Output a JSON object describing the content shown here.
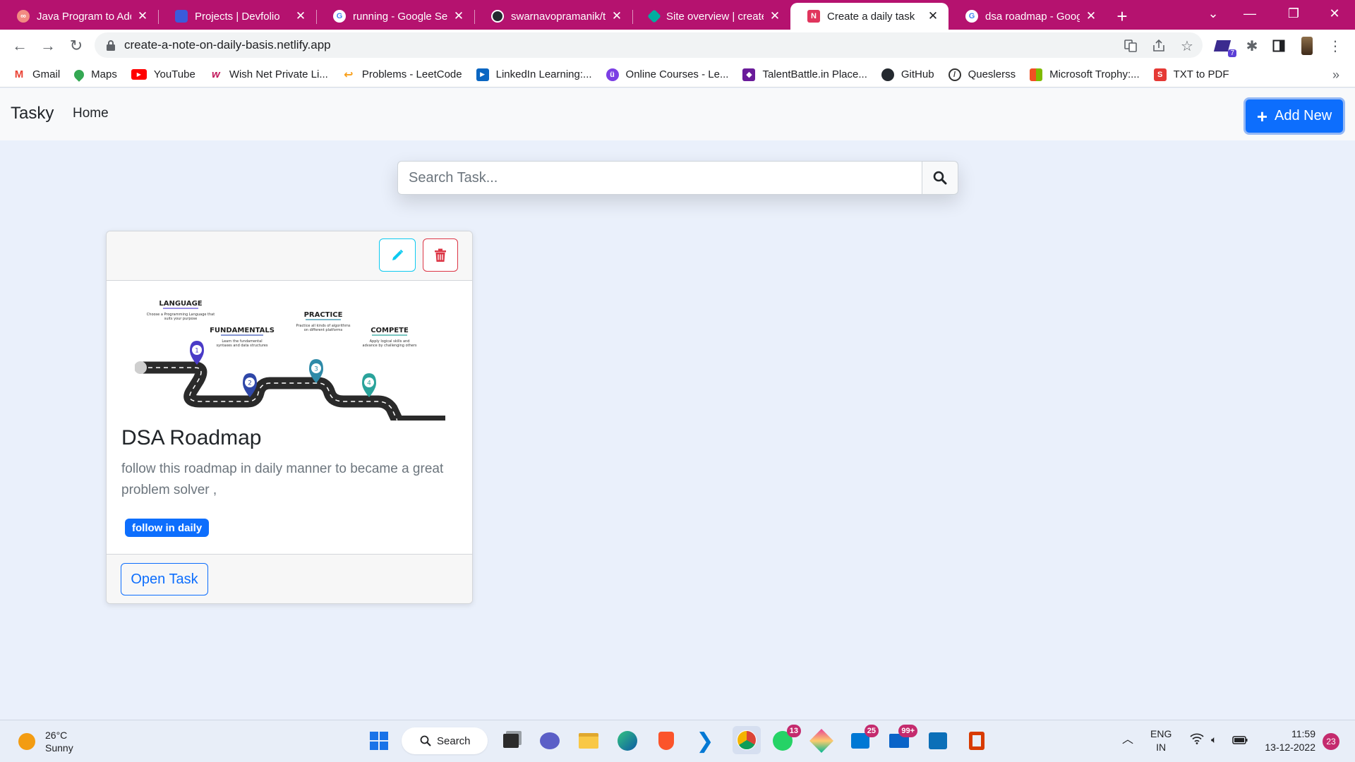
{
  "browser": {
    "tabs": [
      {
        "title": "Java Program to Add",
        "color": "#f28b82"
      },
      {
        "title": "Projects | Devfolio",
        "color": "#3b5bdb"
      },
      {
        "title": "running - Google Sea",
        "color": "#4285f4"
      },
      {
        "title": "swarnavopramanik/ta",
        "color": "#24292f"
      },
      {
        "title": "Site overview | create",
        "color": "#00ad9f"
      },
      {
        "title": "Create a daily task",
        "color": "#e0355d",
        "active": true
      },
      {
        "title": "dsa roadmap - Googl",
        "color": "#4285f4"
      }
    ],
    "url": "create-a-note-on-daily-basis.netlify.app",
    "extension_badge": "7",
    "bookmarks": [
      {
        "label": "Gmail",
        "color": "#ea4335"
      },
      {
        "label": "Maps",
        "color": "#34a853"
      },
      {
        "label": "YouTube",
        "color": "#ff0000"
      },
      {
        "label": "Wish Net Private Li...",
        "color": "#c2185b"
      },
      {
        "label": "Problems - LeetCode",
        "color": "#f89f1b"
      },
      {
        "label": "LinkedIn Learning:...",
        "color": "#0a66c2"
      },
      {
        "label": "Online Courses - Le...",
        "color": "#7b3fe4"
      },
      {
        "label": "TalentBattle.in Place...",
        "color": "#6a1b9a"
      },
      {
        "label": "GitHub",
        "color": "#24292f"
      },
      {
        "label": "Queslerss",
        "color": "#333333"
      },
      {
        "label": "Microsoft Trophy:...",
        "color": "#f25022"
      },
      {
        "label": "TXT to PDF",
        "color": "#e53935"
      }
    ],
    "bookmarks_more": "»"
  },
  "app": {
    "brand": "Tasky",
    "nav_home": "Home",
    "add_new": "Add New",
    "search_placeholder": "Search Task...",
    "card": {
      "title": "DSA Roadmap",
      "description": "follow this roadmap in daily manner to became a great problem solver ,",
      "tag": "follow in daily",
      "open_button": "Open Task",
      "image": {
        "steps": [
          {
            "num": "1",
            "title": "LANGUAGE",
            "desc1": "Choose a Programming Language that",
            "desc2": "suits your purpose"
          },
          {
            "num": "2",
            "title": "FUNDAMENTALS",
            "desc1": "Learn the fundamental",
            "desc2": "syntaxes and data structures"
          },
          {
            "num": "3",
            "title": "PRACTICE",
            "desc1": "Practice all kinds of algorithms",
            "desc2": "on different platforms"
          },
          {
            "num": "4",
            "title": "COMPETE",
            "desc1": "Apply logical skills and",
            "desc2": "advance by challenging others"
          }
        ]
      }
    }
  },
  "taskbar": {
    "temperature": "26°C",
    "weather": "Sunny",
    "search_label": "Search",
    "badges": {
      "whatsapp": "13",
      "store": "25",
      "mail": "99+"
    },
    "language": "ENG",
    "region": "IN",
    "time": "11:59",
    "date": "13-12-2022",
    "notification_count": "23"
  },
  "icons": [
    "tab-close-icon",
    "back-arrow-icon",
    "forward-arrow-icon",
    "reload-icon",
    "lock-icon",
    "translate-icon",
    "share-icon",
    "star-icon",
    "extensions-icon",
    "sidepanel-icon",
    "menu-dots-icon",
    "pencil-icon",
    "trash-icon",
    "search-icon",
    "plus-icon",
    "windows-start-icon",
    "wifi-icon",
    "speaker-icon",
    "battery-icon"
  ]
}
